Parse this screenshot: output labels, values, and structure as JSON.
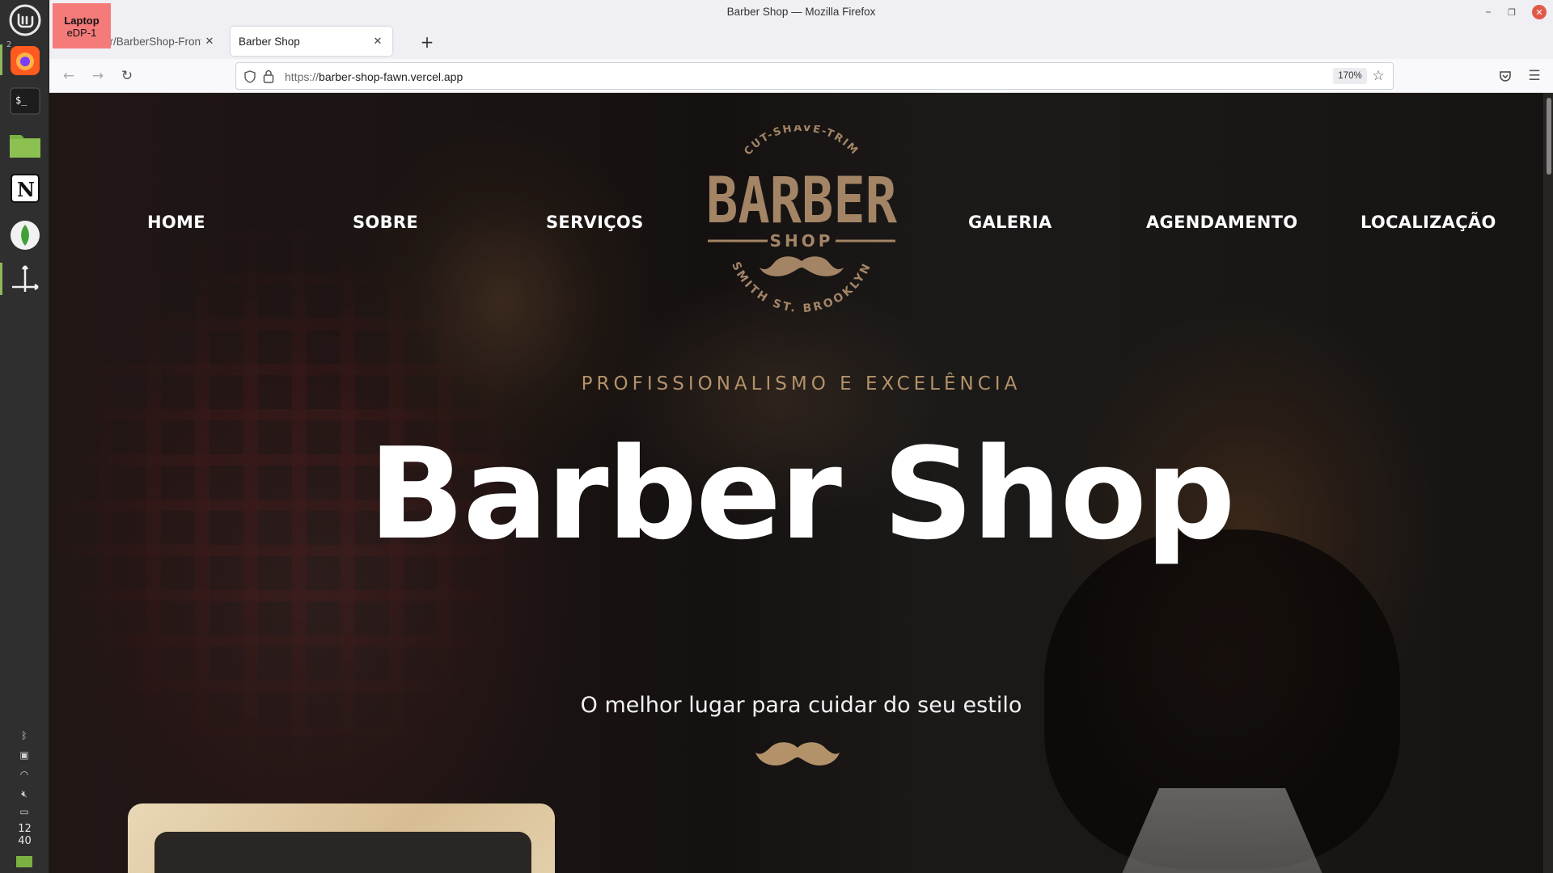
{
  "os": {
    "workspace_number": "2",
    "clock": {
      "hour": "12",
      "minute": "40"
    },
    "display_badge": {
      "line1": "Laptop",
      "line2": "eDP-1"
    }
  },
  "window": {
    "title": "Barber Shop — Mozilla Firefox",
    "controls": {
      "minimize": "–",
      "maximize": "❐",
      "close": "✕"
    }
  },
  "tabs": [
    {
      "label": "walterrr/BarberShop-Front",
      "active": false
    },
    {
      "label": "Barber Shop",
      "active": true
    }
  ],
  "new_tab_label": "+",
  "navigation": {
    "url_scheme": "https://",
    "url_host": "barber-shop-fawn.vercel.app",
    "zoom": "170%"
  },
  "site": {
    "menu_left": [
      "HOME",
      "SOBRE",
      "SERVIÇOS"
    ],
    "menu_right": [
      "GALERIA",
      "AGENDAMENTO",
      "LOCALIZAÇÃO"
    ],
    "logo": {
      "top_arc": "CUT-SHAVE-TRIM",
      "main": "BARBER",
      "sub": "SHOP",
      "bottom_arc": "SMITH ST. BROOKLYN"
    },
    "eyebrow": "PROFISSIONALISMO E EXCELÊNCIA",
    "title": "Barber Shop",
    "subtitle": "O melhor lugar para cuidar do seu estilo"
  },
  "colors": {
    "accent_gold": "#b3926a",
    "logo_tan": "#a38566",
    "firefox_chrome": "#f0f0f4"
  }
}
